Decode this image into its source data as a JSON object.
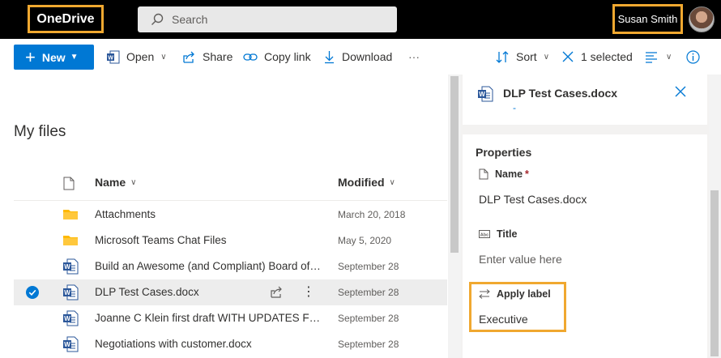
{
  "topbar": {
    "brand": "OneDrive",
    "search_placeholder": "Search",
    "user_name": "Susan Smith"
  },
  "commands": {
    "new": "New",
    "open": "Open",
    "share": "Share",
    "copy_link": "Copy link",
    "download": "Download",
    "more": "···",
    "sort": "Sort",
    "selected": "1 selected"
  },
  "files": {
    "title": "My files",
    "col_name": "Name",
    "col_modified": "Modified",
    "rows": [
      {
        "name": "Attachments",
        "modified": "March 20, 2018",
        "type": "folder"
      },
      {
        "name": "Microsoft Teams Chat Files",
        "modified": "May 5, 2020",
        "type": "folder"
      },
      {
        "name": "Build an Awesome (and Compliant) Board of Directors Portal",
        "modified": "September 28",
        "type": "word"
      },
      {
        "name": "DLP Test Cases.docx",
        "modified": "September 28",
        "type": "word",
        "selected": true
      },
      {
        "name": "Joanne C Klein first draft WITH UPDATES FROM REVIEW.docx",
        "modified": "September 28",
        "type": "word"
      },
      {
        "name": "Negotiations with customer.docx",
        "modified": "September 28",
        "type": "word"
      }
    ]
  },
  "details": {
    "file_name": "DLP Test Cases.docx",
    "subtitle": "-",
    "properties_header": "Properties",
    "name_label": "Name",
    "name_required": "*",
    "name_value": "DLP Test Cases.docx",
    "title_label": "Title",
    "title_placeholder": "Enter value here",
    "apply_label_label": "Apply label",
    "apply_label_value": "Executive"
  },
  "colors": {
    "accent": "#0078d4",
    "highlight": "#f0a830",
    "topbar": "#000000"
  }
}
